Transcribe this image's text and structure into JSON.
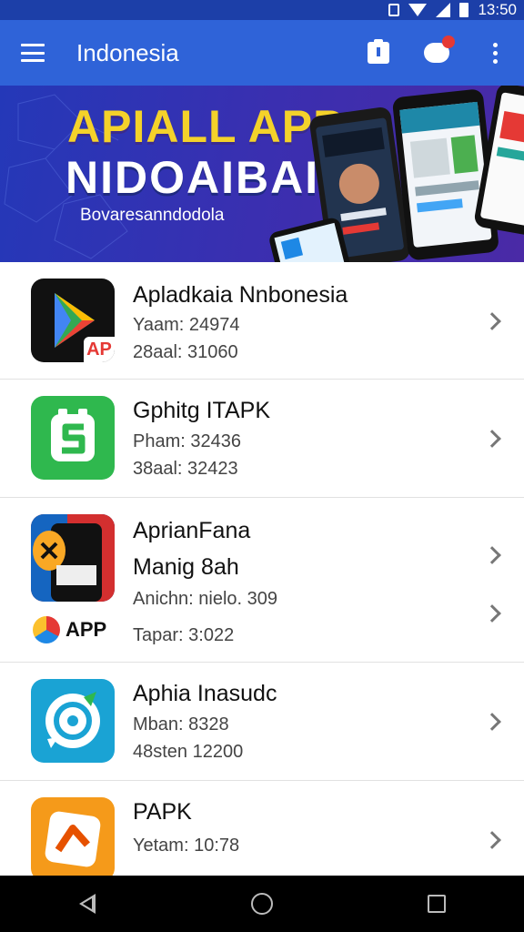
{
  "status_bar": {
    "time": "13:50",
    "icons": [
      "vibrate-icon",
      "wifi-icon",
      "signal-icon",
      "battery-icon"
    ]
  },
  "app_bar": {
    "title": "Indonesia",
    "actions": [
      "clipboard-icon",
      "chat-notification-icon",
      "more-options-icon"
    ]
  },
  "banner": {
    "line1": "APIALL APP",
    "line2": "NIDOAIBAI",
    "subtitle": "Bovaresanndodola"
  },
  "apps": [
    {
      "title": "Apladkaia Nnbonesia",
      "meta1": "Yaam: 24974",
      "meta2": "28aal: 31060",
      "icon": "play-store-icon",
      "badge": "AP"
    },
    {
      "title": "Gphitg ITAPK",
      "meta1": "Pham: 32436",
      "meta2": "38aal: 32423",
      "icon": "green-s-app-icon"
    },
    {
      "title": "AprianFana",
      "title2": "Manig 8ah",
      "meta1": "Anichn: nielo. 309",
      "meta2": "Tapar: 3:022",
      "icon": "game-app-icon",
      "brand": "APP"
    },
    {
      "title": "Aphia Inasudc",
      "meta1": "Mban:  8328",
      "meta2": "48sten 12200",
      "icon": "blue-chat-app-icon"
    },
    {
      "title": "PAPK",
      "meta1": "Yetam: 10:78",
      "icon": "orange-app-icon"
    }
  ],
  "colors": {
    "status_bar": "#1c3fa8",
    "app_bar": "#2f63d8",
    "banner_yellow": "#f4d22a",
    "banner_bg": "#3a2fb0"
  },
  "nav_bar": [
    "back-icon",
    "home-icon",
    "recents-icon"
  ]
}
